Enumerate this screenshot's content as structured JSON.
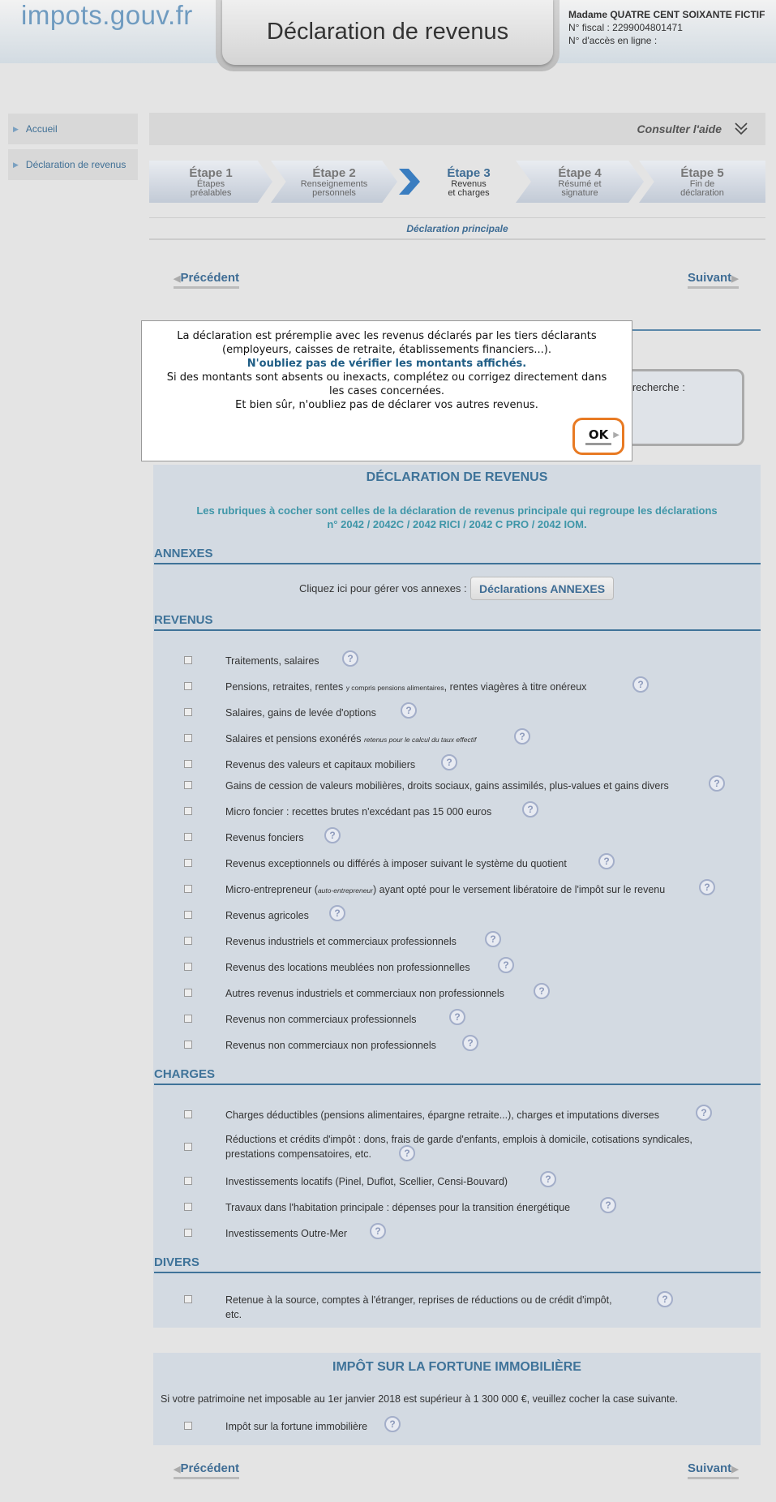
{
  "header": {
    "logo": "impots.gouv.fr",
    "title": "Déclaration de revenus",
    "user_name": "Madame QUATRE CENT SOIXANTE FICTIF",
    "fiscal_number": "N° fiscal : 2299004801471",
    "online_access": "N° d'accès en ligne :"
  },
  "sidebar": {
    "items": [
      {
        "label": "Accueil"
      },
      {
        "label": "Déclaration de revenus"
      }
    ]
  },
  "help": {
    "label": "Consulter l'aide"
  },
  "steps": [
    {
      "title": "Étape 1",
      "line1": "Étapes",
      "line2": "préalables"
    },
    {
      "title": "Étape 2",
      "line1": "Renseignements",
      "line2": "personnels"
    },
    {
      "title": "Étape 3",
      "line1": "Revenus",
      "line2": "et charges"
    },
    {
      "title": "Étape 4",
      "line1": "Résumé et",
      "line2": "signature"
    },
    {
      "title": "Étape 5",
      "line1": "Fin de",
      "line2": "déclaration"
    }
  ],
  "subheading": "Déclaration principale",
  "nav": {
    "prev": "Précédent",
    "next": "Suivant",
    "prev_arrow": "◀",
    "next_arrow": "▶"
  },
  "background_search": "e recherche :",
  "modal": {
    "line1": "La déclaration est préremplie avec les revenus déclarés par les tiers déclarants",
    "line2": "(employeurs, caisses de retraite, établissements financiers...).",
    "line3": "N'oubliez pas de vérifier les montants affichés.",
    "line4": "Si des montants sont absents ou inexacts, complétez ou corrigez directement dans",
    "line5": "les cases concernées.",
    "line6": "Et bien sûr, n'oubliez pas de déclarer vos autres revenus.",
    "ok": "OK"
  },
  "main": {
    "title": "DÉCLARATION DE REVENUS",
    "sub1": "Les rubriques à cocher sont celles de la déclaration de revenus principale qui regroupe les déclarations",
    "sub2": "n° 2042 / 2042C / 2042 RICI / 2042 C PRO / 2042 IOM."
  },
  "annexes": {
    "heading": "ANNEXES",
    "text": "Cliquez ici pour gérer vos annexes :",
    "button": "Déclarations ANNEXES"
  },
  "revenus": {
    "heading": "REVENUS",
    "items": [
      {
        "label": "Traitements, salaires"
      },
      {
        "label": "Pensions, retraites, rentes ",
        "small": "y compris pensions alimentaires",
        "after": ", rentes viagères à titre onéreux"
      },
      {
        "label": "Salaires, gains de levée d'options"
      },
      {
        "label": "Salaires et pensions exonérés ",
        "small": "retenus pour le calcul du taux effectif"
      },
      {
        "label": "Revenus des valeurs et capitaux mobiliers"
      },
      {
        "label": "Gains de cession de valeurs mobilières, droits sociaux, gains assimilés, plus-values et gains divers"
      },
      {
        "label": "Micro foncier : recettes brutes n'excédant pas 15 000 euros"
      },
      {
        "label": "Revenus fonciers"
      },
      {
        "label": "Revenus exceptionnels ou différés à imposer suivant le système du quotient"
      },
      {
        "label": "Micro-entrepreneur (",
        "small": "auto-entrepreneur",
        "after": ") ayant opté pour le versement libératoire de l'impôt sur le revenu"
      },
      {
        "label": "Revenus agricoles"
      },
      {
        "label": "Revenus industriels et commerciaux professionnels"
      },
      {
        "label": "Revenus des locations meublées non professionnelles"
      },
      {
        "label": "Autres revenus industriels et commerciaux non professionnels"
      },
      {
        "label": "Revenus non commerciaux professionnels"
      },
      {
        "label": "Revenus non commerciaux non professionnels"
      }
    ]
  },
  "charges": {
    "heading": "CHARGES",
    "items": [
      {
        "label": "Charges déductibles (pensions alimentaires, épargne retraite...), charges et imputations diverses"
      },
      {
        "label": "Réductions et crédits d'impôt : dons, frais de garde d'enfants, emplois à domicile, cotisations syndicales,",
        "line2": "prestations compensatoires, etc."
      },
      {
        "label": "Investissements locatifs (Pinel, Duflot, Scellier, Censi-Bouvard)"
      },
      {
        "label": "Travaux dans l'habitation principale : dépenses pour la transition énergétique"
      },
      {
        "label": "Investissements Outre-Mer"
      }
    ]
  },
  "divers": {
    "heading": "DIVERS",
    "items": [
      {
        "label": "Retenue à la source, comptes à l'étranger, reprises de réductions ou de crédit d'impôt,",
        "line2": "etc."
      }
    ]
  },
  "ifi": {
    "title": "IMPÔT SUR LA FORTUNE IMMOBILIÈRE",
    "text": "Si votre patrimoine net imposable au 1er janvier 2018 est supérieur à 1 300 000 €, veuillez cocher la case suivante.",
    "item": "Impôt sur la fortune immobilière"
  },
  "icons": {
    "help": "?",
    "side_arrow": "▶"
  },
  "colors": {
    "accent": "#3f7399",
    "panel": "#d3dae2",
    "ok_border": "#e87a23"
  }
}
